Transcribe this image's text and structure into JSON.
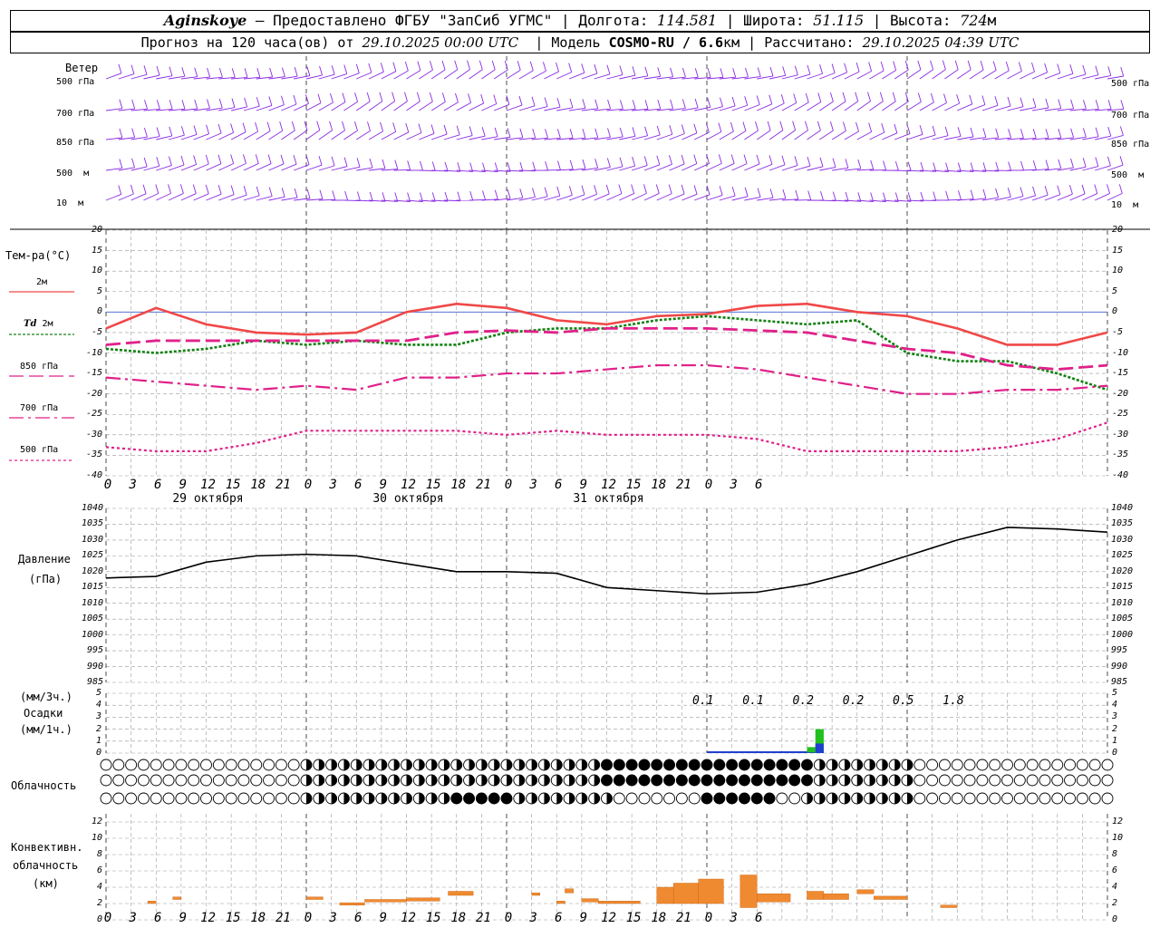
{
  "header": {
    "station": "Aginskoye",
    "provider": " – Предоставлено ФГБУ \"ЗапСиб УГМС\" | Долгота: ",
    "lon": "114.581",
    "lat_label": " | Широта: ",
    "lat": "51.115",
    "alt_label": " | Высота: ",
    "alt": "724",
    "alt_unit": "м",
    "forecast_label": "Прогноз на 120 часа(ов) от ",
    "init_time": "29.10.2025 00:00 UTC",
    "model_label": "  | Модель ",
    "model": "COSMO-RU / 6.6",
    "model_unit": "км",
    "calc_label": " | Рассчитано: ",
    "calc_time": "29.10.2025 04:39 UTC"
  },
  "labels": {
    "wind": "Ветер",
    "wind_levels": [
      "500 гПа",
      "700 гПа",
      "850 гПа",
      "500  м",
      "10  м"
    ],
    "temp_title": "Тем-ра(°C)",
    "legend_2m": "2м",
    "legend_td": "Td",
    "legend_td2": "2м",
    "legend_850": "850 гПа",
    "legend_700": "700 гПа",
    "legend_500": "500 гПа",
    "pressure_title": "Давление",
    "pressure_unit": "(гПа)",
    "precip_unit3": "(мм/3ч.)",
    "precip_title": "Осадки",
    "precip_unit1": "(мм/1ч.)",
    "cloud_title": "Облачность",
    "conv_title1": "Конвективн.",
    "conv_title2": "облачность",
    "conv_unit": "(км)"
  },
  "x_ticks": [
    "0",
    "3",
    "6",
    "9",
    "12",
    "15",
    "18",
    "21",
    "0",
    "3",
    "6",
    "9",
    "12",
    "15",
    "18",
    "21",
    "0",
    "3",
    "6",
    "9",
    "12",
    "15",
    "18",
    "21",
    "0",
    "3",
    "6"
  ],
  "days": [
    "29 октября",
    "30 октября",
    "31 октября"
  ],
  "temp_ticks": [
    "20",
    "15",
    "10",
    "5",
    "0",
    "-5",
    "-10",
    "-15",
    "-20",
    "-25",
    "-30",
    "-35",
    "-40"
  ],
  "pressure_ticks": [
    "1040",
    "1035",
    "1030",
    "1025",
    "1020",
    "1015",
    "1010",
    "1005",
    "1000",
    "995",
    "990",
    "985"
  ],
  "precip_ticks": [
    "5",
    "4",
    "3",
    "2",
    "1",
    "0"
  ],
  "conv_ticks": [
    "12",
    "10",
    "8",
    "6",
    "4",
    "2",
    "0"
  ],
  "precip_totals": [
    "0.1",
    "0.1",
    "0.2",
    "0.2",
    "0.5",
    "1.8"
  ],
  "colors": {
    "t2m": "#f04848",
    "td": "#108010",
    "t850": "#e0208a",
    "t700": "#e0208a",
    "t500": "#e0208a",
    "pressure": "#000000",
    "wind": "#8a2be2",
    "conv": "#f08a30",
    "precip_green": "#20c020",
    "precip_blue": "#2040d0",
    "grid": "#9a9a9a"
  },
  "chart_data": [
    {
      "type": "line",
      "title": "Тем-ра(°C)",
      "x_hours": [
        0,
        6,
        12,
        18,
        24,
        30,
        36,
        42,
        48,
        54,
        60,
        66,
        72,
        78,
        84,
        90,
        96,
        102,
        108,
        114,
        120
      ],
      "ylim": [
        -40,
        20
      ],
      "series": [
        {
          "name": "2м",
          "values": [
            -4,
            1,
            -3,
            -5,
            -5.5,
            -5,
            0,
            2,
            1,
            -2,
            -3,
            -1,
            -0.5,
            1.5,
            2,
            0,
            -1,
            -4,
            -8,
            -8,
            -5
          ]
        },
        {
          "name": "Td 2м",
          "values": [
            -9,
            -10,
            -9,
            -7,
            -8,
            -7,
            -8,
            -8,
            -5,
            -4,
            -4,
            -2,
            -1,
            -2,
            -3,
            -2,
            -10,
            -12,
            -12,
            -15,
            -19
          ]
        },
        {
          "name": "850 гПа",
          "values": [
            -8,
            -7,
            -7,
            -7,
            -7,
            -7,
            -7,
            -5,
            -4.5,
            -5,
            -4,
            -4,
            -4,
            -4.5,
            -5,
            -7,
            -9,
            -10,
            -13,
            -14,
            -13
          ]
        },
        {
          "name": "700 гПа",
          "values": [
            -16,
            -17,
            -18,
            -19,
            -18,
            -19,
            -16,
            -16,
            -15,
            -15,
            -14,
            -13,
            -13,
            -14,
            -16,
            -18,
            -20,
            -20,
            -19,
            -19,
            -18
          ]
        },
        {
          "name": "500 гПа",
          "values": [
            -33,
            -34,
            -34,
            -32,
            -29,
            -29,
            -29,
            -29,
            -30,
            -29,
            -30,
            -30,
            -30,
            -31,
            -34,
            -34,
            -34,
            -34,
            -33,
            -31,
            -27
          ]
        }
      ]
    },
    {
      "type": "line",
      "title": "Давление",
      "ylabel": "(гПа)",
      "x_hours": [
        0,
        6,
        12,
        18,
        24,
        30,
        36,
        42,
        48,
        54,
        60,
        66,
        72,
        78,
        84,
        90,
        96,
        102,
        108,
        114,
        120
      ],
      "ylim": [
        985,
        1040
      ],
      "series": [
        {
          "name": "Давление",
          "values": [
            1018,
            1018.5,
            1023,
            1025,
            1025.5,
            1025,
            1022.5,
            1020,
            1020,
            1019.5,
            1015,
            1014,
            1013,
            1013.5,
            1016,
            1020,
            1025,
            1030,
            1034,
            1033.5,
            1032.5
          ]
        }
      ]
    },
    {
      "type": "bar",
      "title": "Осадки",
      "ylabel": "(мм/1ч.)",
      "ylim": [
        0,
        5
      ],
      "x_hours": [
        84,
        85
      ],
      "series": [
        {
          "name": "green",
          "values": [
            0.5,
            2.0
          ]
        },
        {
          "name": "blue",
          "values": [
            0.05,
            0.8
          ]
        }
      ]
    },
    {
      "type": "bar",
      "title": "Конвективн. облачность",
      "ylabel": "(км)",
      "ylim": [
        0,
        13
      ],
      "segments": [
        {
          "x0": 5,
          "x1": 6,
          "bottom": 2,
          "top": 2.3
        },
        {
          "x0": 8,
          "x1": 9,
          "bottom": 2.5,
          "top": 2.8
        },
        {
          "x0": 24,
          "x1": 26,
          "bottom": 2.5,
          "top": 2.8
        },
        {
          "x0": 28,
          "x1": 31,
          "bottom": 1.8,
          "top": 2.1
        },
        {
          "x0": 31,
          "x1": 36,
          "bottom": 2.2,
          "top": 2.5
        },
        {
          "x0": 36,
          "x1": 40,
          "bottom": 2.3,
          "top": 2.7
        },
        {
          "x0": 41,
          "x1": 44,
          "bottom": 3.0,
          "top": 3.5
        },
        {
          "x0": 51,
          "x1": 52,
          "bottom": 3.0,
          "top": 3.3
        },
        {
          "x0": 54,
          "x1": 55,
          "bottom": 2.0,
          "top": 2.3
        },
        {
          "x0": 55,
          "x1": 56,
          "bottom": 3.3,
          "top": 3.8
        },
        {
          "x0": 57,
          "x1": 59,
          "bottom": 2.2,
          "top": 2.6
        },
        {
          "x0": 59,
          "x1": 64,
          "bottom": 2.0,
          "top": 2.3
        },
        {
          "x0": 66,
          "x1": 68,
          "bottom": 2,
          "top": 4
        },
        {
          "x0": 68,
          "x1": 71,
          "bottom": 2,
          "top": 4.5
        },
        {
          "x0": 71,
          "x1": 74,
          "bottom": 2,
          "top": 5
        },
        {
          "x0": 76,
          "x1": 78,
          "bottom": 1.5,
          "top": 5.5
        },
        {
          "x0": 78,
          "x1": 82,
          "bottom": 2.2,
          "top": 3.2
        },
        {
          "x0": 84,
          "x1": 86,
          "bottom": 2.5,
          "top": 3.5
        },
        {
          "x0": 86,
          "x1": 89,
          "bottom": 2.5,
          "top": 3.2
        },
        {
          "x0": 90,
          "x1": 92,
          "bottom": 3.2,
          "top": 3.7
        },
        {
          "x0": 92,
          "x1": 96,
          "bottom": 2.5,
          "top": 2.9
        },
        {
          "x0": 100,
          "x1": 102,
          "bottom": 1.5,
          "top": 1.8
        }
      ]
    }
  ]
}
